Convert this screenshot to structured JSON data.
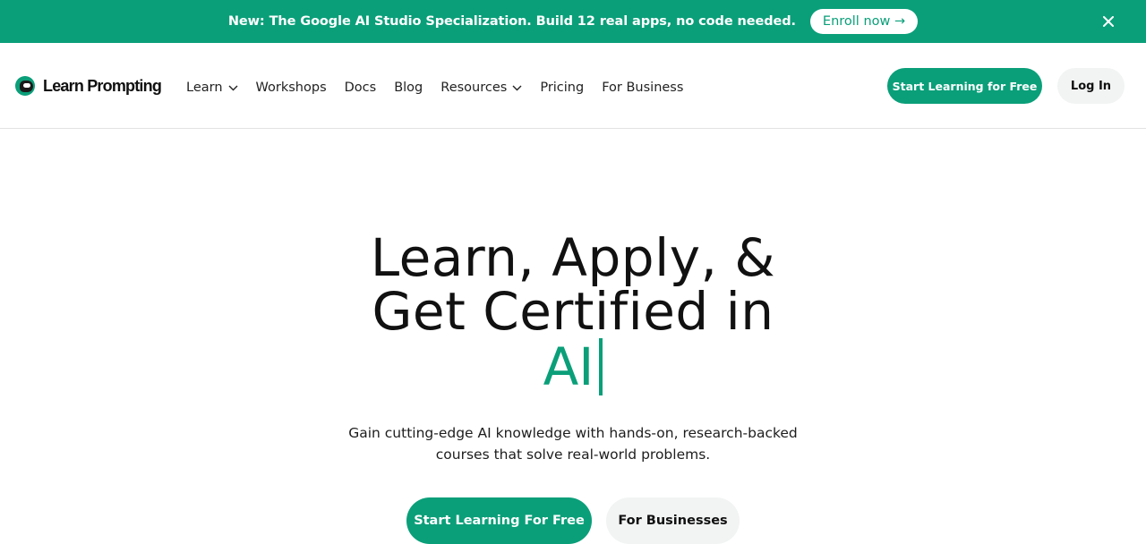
{
  "colors": {
    "accent": "#0a9f79",
    "button_light": "#f2f3f3",
    "text": "#111111"
  },
  "announcement": {
    "text": "New: The Google AI Studio Specialization. Build 12 real apps, no code needed.",
    "cta_label": "Enroll now →",
    "close_icon": "close-icon"
  },
  "header": {
    "logo_text": "Learn Prompting",
    "nav": [
      {
        "label": "Learn",
        "icon": "chevron-down-icon"
      },
      {
        "label": "Workshops"
      },
      {
        "label": "Docs"
      },
      {
        "label": "Blog"
      },
      {
        "label": "Resources",
        "icon": "chevron-down-icon"
      },
      {
        "label": "Pricing"
      },
      {
        "label": "For Business"
      }
    ],
    "cta_label": "Start Learning for Free",
    "login_label": "Log In"
  },
  "hero": {
    "title_line1": "Learn, Apply, &",
    "title_line2": "Get Certified in",
    "title_accent": "AI",
    "subtitle_line1": "Gain cutting-edge AI knowledge with hands-on, research-backed",
    "subtitle_line2": "courses that solve real-world problems.",
    "primary_cta": "Start Learning For Free",
    "secondary_cta": "For Businesses"
  }
}
